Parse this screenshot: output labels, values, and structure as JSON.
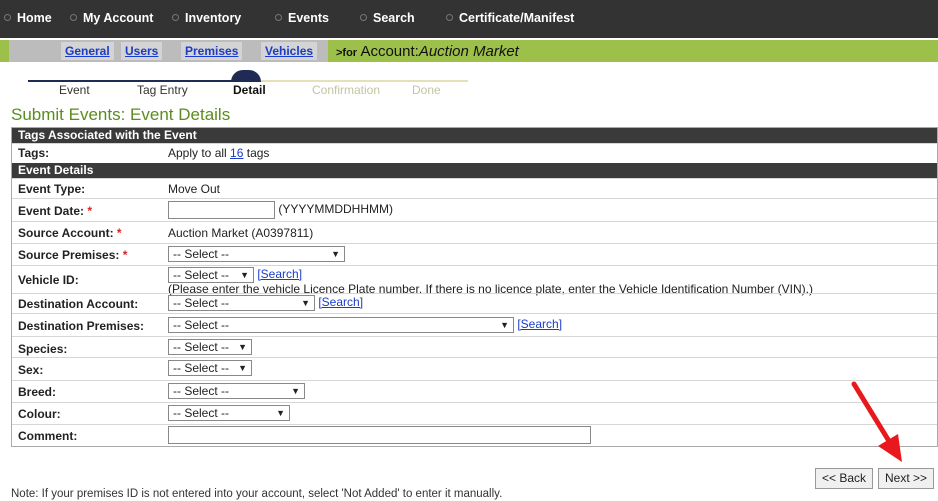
{
  "nav": {
    "home": "Home",
    "my_account": "My Account",
    "inventory": "Inventory",
    "events": "Events",
    "search": "Search",
    "certificate": "Certificate/Manifest"
  },
  "subnav": {
    "general": "General",
    "users": "Users",
    "premises": "Premises",
    "vehicles": "Vehicles",
    "account_prefix": ">for",
    "account_label": "Account:",
    "account_name": "Auction Market"
  },
  "steps": {
    "event": "Event",
    "tag_entry": "Tag Entry",
    "detail": "Detail",
    "confirmation": "Confirmation",
    "done": "Done"
  },
  "page_title": "Submit Events: Event Details",
  "tags_section": {
    "header": "Tags Associated with the Event",
    "label": "Tags:",
    "apply_prefix": "Apply to all",
    "count": "16",
    "apply_suffix": "tags"
  },
  "details_section": {
    "header": "Event Details",
    "event_type_label": "Event Type:",
    "event_type_value": "Move Out",
    "event_date_label": "Event Date:",
    "event_date_value": "",
    "event_date_format": "(YYYYMMDDHHMM)",
    "source_account_label": "Source Account:",
    "source_account_value": "Auction Market (A0397811)",
    "source_premises_label": "Source Premises:",
    "vehicle_label": "Vehicle ID:",
    "vehicle_hint": "(Please enter the vehicle Licence Plate number. If there is no licence plate, enter the Vehicle Identification Number (VIN).)",
    "dest_account_label": "Destination Account:",
    "dest_premises_label": "Destination Premises:",
    "species_label": "Species:",
    "sex_label": "Sex:",
    "breed_label": "Breed:",
    "colour_label": "Colour:",
    "comment_label": "Comment:",
    "comment_value": "",
    "select_placeholder": "-- Select --",
    "search_link": "[Search]",
    "required_mark": "*"
  },
  "buttons": {
    "back": "<< Back",
    "next": "Next >>"
  },
  "note": "Note: If your premises ID is not entered into your account, select 'Not Added' to enter it manually.",
  "colors": {
    "accent_green": "#9cc04a",
    "title_green": "#5a8d1e",
    "nav_dark": "#333333",
    "annotation_arrow": "#e8191c"
  }
}
